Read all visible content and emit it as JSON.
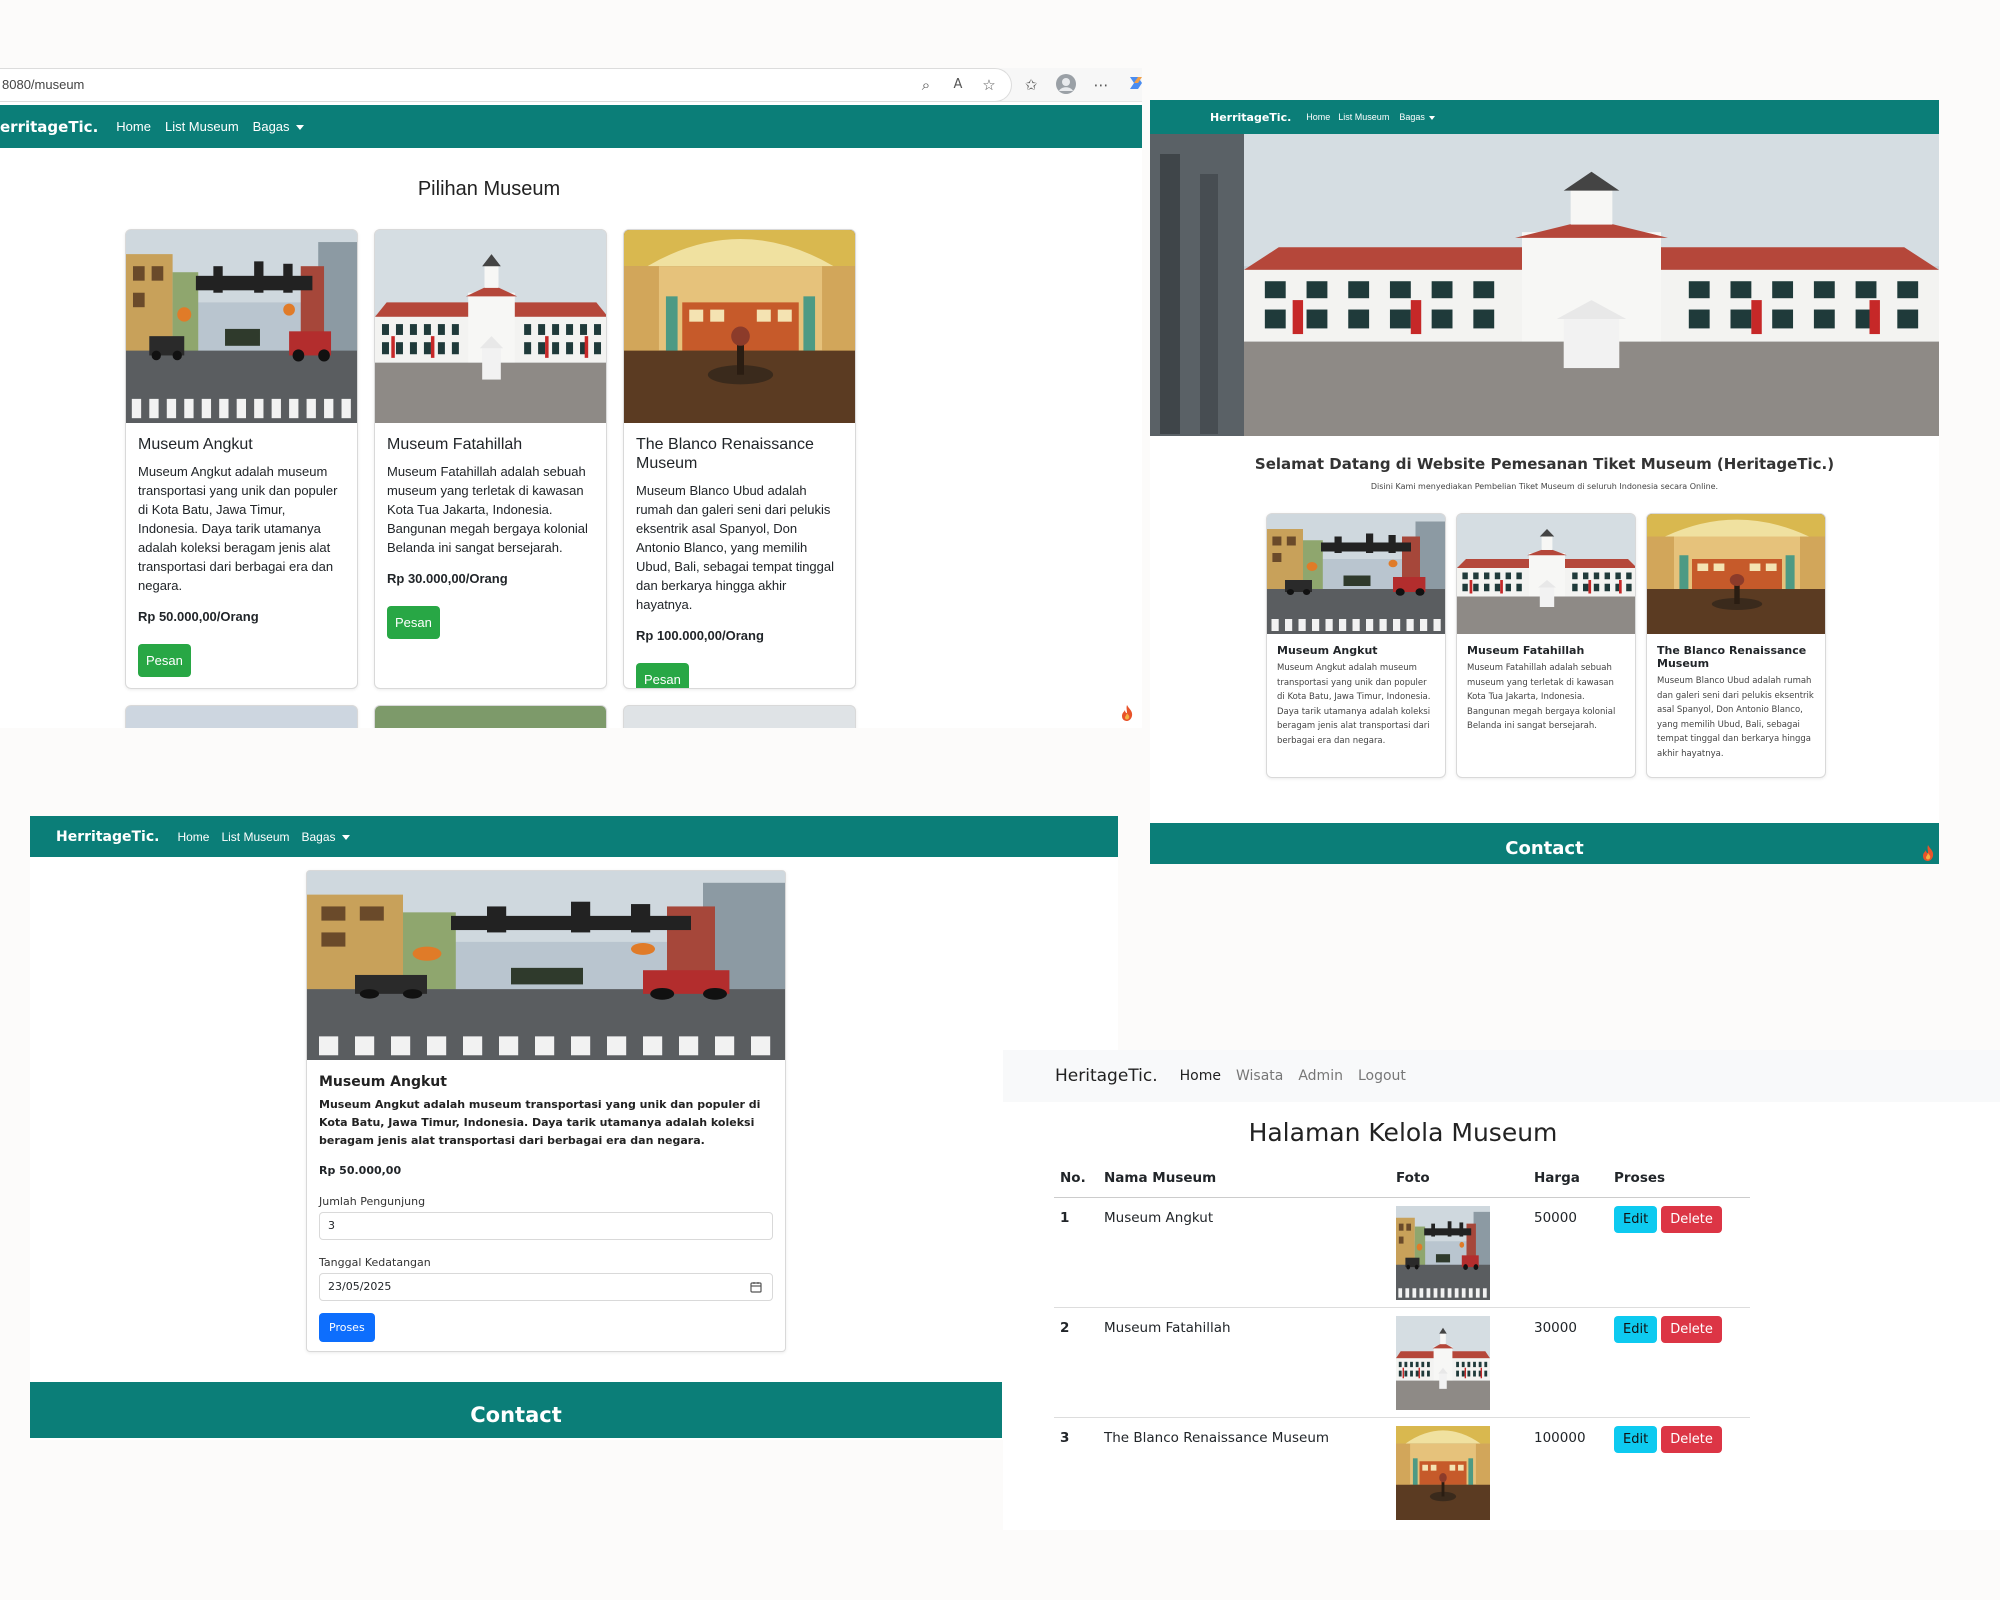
{
  "browser": {
    "url": "8080/museum"
  },
  "nav": {
    "brand": "HerritageTic.",
    "brand_cropped": "erritageTic.",
    "links": [
      "Home",
      "List Museum",
      "Bagas"
    ]
  },
  "museums": [
    {
      "name": "Museum Angkut",
      "desc": "Museum Angkut adalah museum transportasi yang unik dan populer di Kota Batu, Jawa Timur, Indonesia. Daya tarik utamanya adalah koleksi beragam jenis alat transportasi dari berbagai era dan negara.",
      "price": "Rp 50.000,00/Orang"
    },
    {
      "name": "Museum Fatahillah",
      "desc": "Museum Fatahillah adalah sebuah museum yang terletak di kawasan Kota Tua Jakarta, Indonesia. Bangunan megah bergaya kolonial Belanda ini sangat bersejarah.",
      "price": "Rp 30.000,00/Orang"
    },
    {
      "name": "The Blanco Renaissance Museum",
      "desc": "Museum Blanco Ubud adalah rumah dan galeri seni dari pelukis eksentrik asal Spanyol, Don Antonio Blanco, yang memilih Ubud, Bali, sebagai tempat tinggal dan berkarya hingga akhir hayatnya.",
      "price": "Rp 100.000,00/Orang"
    }
  ],
  "list_page": {
    "heading": "Pilihan Museum",
    "order_button": "Pesan"
  },
  "home_page": {
    "welcome": "Selamat Datang di Website Pemesanan Tiket Museum (HeritageTic.)",
    "subtitle": "Disini Kami menyediakan Pembelian Tiket Museum di seluruh Indonesia secara Online.",
    "footer": "Contact"
  },
  "booking_page": {
    "name": "Museum Angkut",
    "desc": "Museum Angkut adalah museum transportasi yang unik dan populer di Kota Batu, Jawa Timur, Indonesia. Daya tarik utamanya adalah koleksi beragam jenis alat transportasi dari berbagai era dan negara.",
    "price": "Rp 50.000,00",
    "visitors_label": "Jumlah Pengunjung",
    "visitors_value": "3",
    "date_label": "Tanggal Kedatangan",
    "date_value": "23/05/2025",
    "submit": "Proses",
    "footer": "Contact"
  },
  "admin_page": {
    "brand": "HeritageTic.",
    "nav": [
      "Home",
      "Wisata",
      "Admin",
      "Logout"
    ],
    "heading": "Halaman Kelola Museum",
    "columns": [
      "No.",
      "Nama Museum",
      "Foto",
      "Harga",
      "Proses"
    ],
    "rows": [
      {
        "no": "1",
        "name": "Museum Angkut",
        "price": "50000"
      },
      {
        "no": "2",
        "name": "Museum Fatahillah",
        "price": "30000"
      },
      {
        "no": "3",
        "name": "The Blanco Renaissance Museum",
        "price": "100000"
      }
    ],
    "edit": "Edit",
    "delete": "Delete"
  },
  "colors": {
    "navbar": "#0b7e78",
    "order_button": "#28a745",
    "submit_button": "#0d6efd",
    "edit_button": "#0dcaf0",
    "delete_button": "#dc3545"
  }
}
